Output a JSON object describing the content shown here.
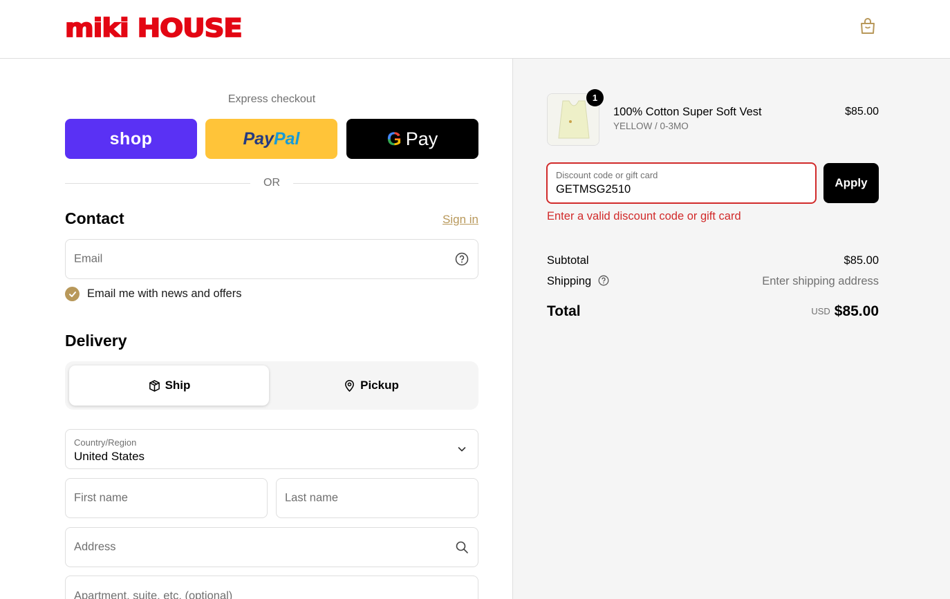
{
  "header": {
    "brand": "miki HOUSE",
    "cart_icon": "shopping-bag-icon"
  },
  "express": {
    "title": "Express checkout",
    "shop_label": "shop",
    "paypal_part1": "Pay",
    "paypal_part2": "Pal",
    "gpay_g": "G",
    "gpay_label": "Pay",
    "or": "OR"
  },
  "contact": {
    "title": "Contact",
    "signin": "Sign in",
    "email_placeholder": "Email",
    "newsletter_label": "Email me with news and offers",
    "newsletter_checked": true
  },
  "delivery": {
    "title": "Delivery",
    "ship_label": "Ship",
    "pickup_label": "Pickup",
    "selected": "Ship",
    "country_label": "Country/Region",
    "country_value": "United States",
    "first_name_placeholder": "First name",
    "last_name_placeholder": "Last name",
    "address_placeholder": "Address",
    "apartment_placeholder": "Apartment, suite, etc. (optional)"
  },
  "summary": {
    "item": {
      "name": "100% Cotton Super Soft Vest",
      "variant": "YELLOW / 0-3MO",
      "price": "$85.00",
      "quantity": "1"
    },
    "discount": {
      "label": "Discount code or gift card",
      "value": "GETMSG2510",
      "apply": "Apply",
      "error": "Enter a valid discount code or gift card"
    },
    "subtotal_label": "Subtotal",
    "subtotal_value": "$85.00",
    "shipping_label": "Shipping",
    "shipping_value": "Enter shipping address",
    "total_label": "Total",
    "total_currency": "USD",
    "total_value": "$85.00"
  },
  "colors": {
    "brand_red": "#e30613",
    "accent_gold": "#b8985a",
    "error_red": "#d12a2a",
    "shop_purple": "#5a31f4",
    "paypal_yellow": "#ffc439"
  }
}
